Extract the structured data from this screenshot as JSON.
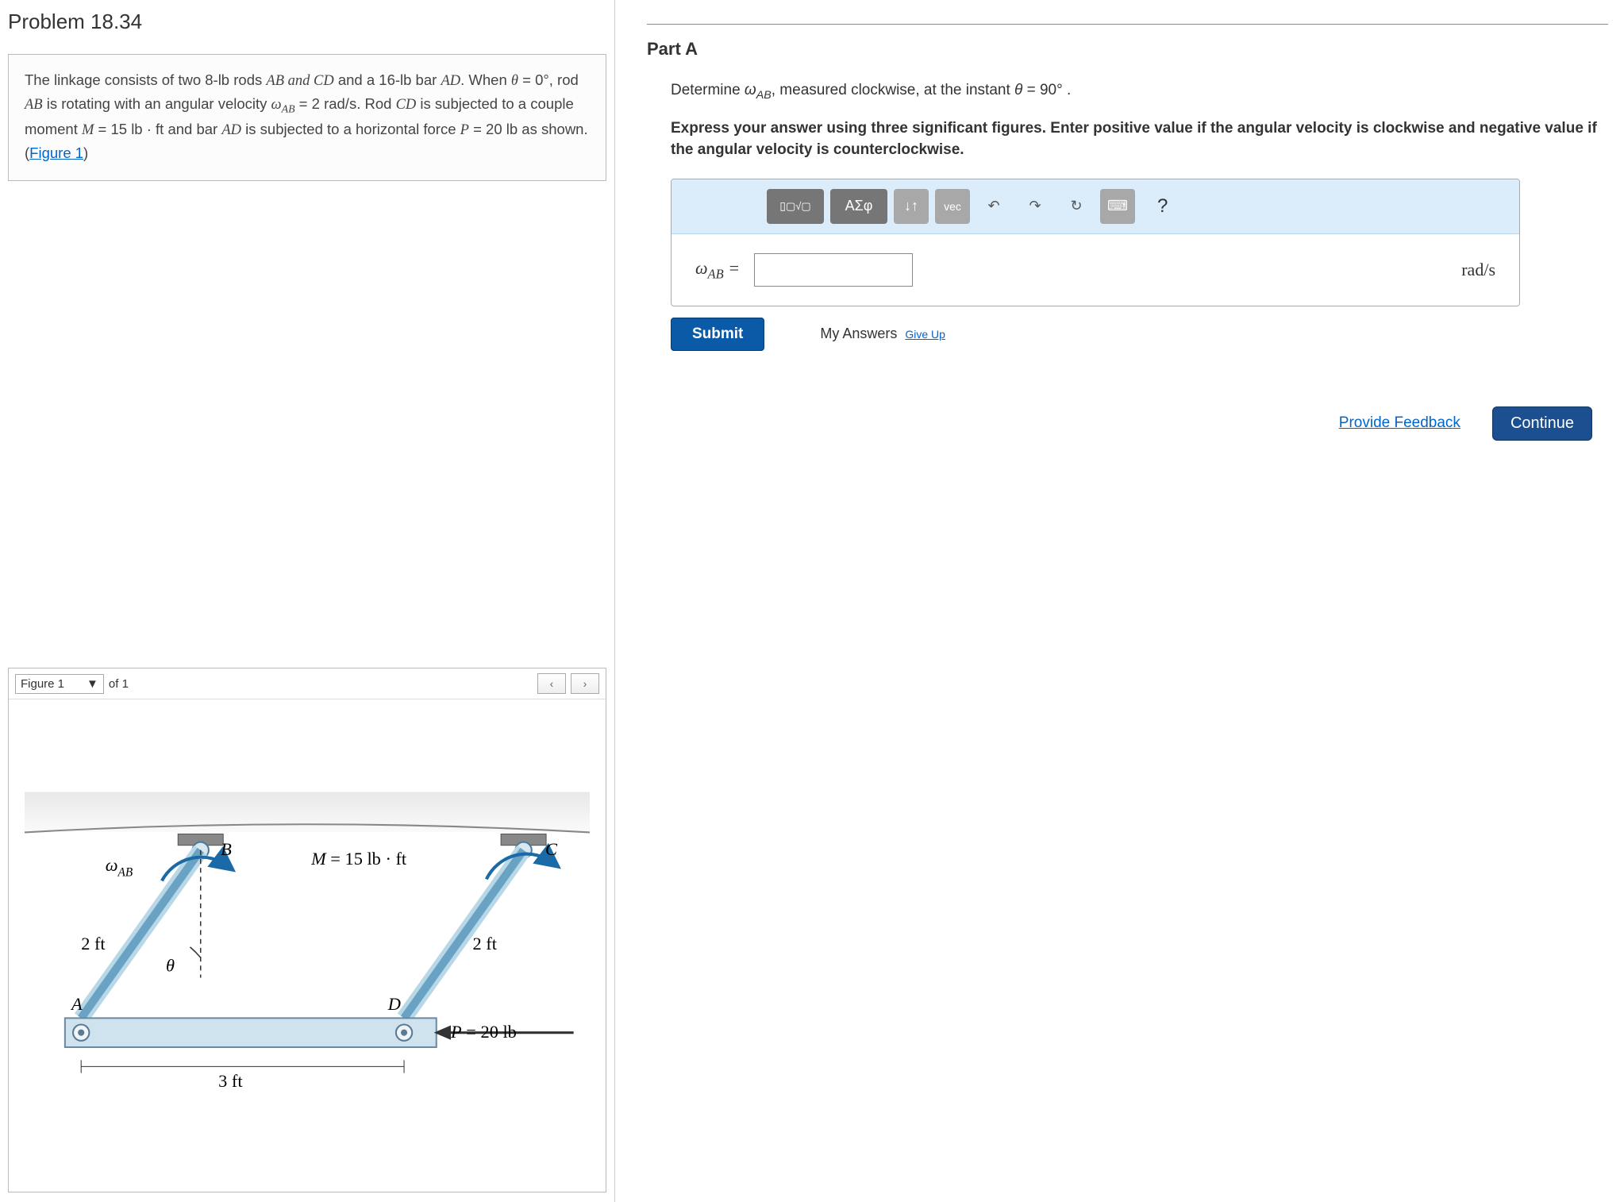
{
  "problem": {
    "title": "Problem 18.34",
    "linkage_rods_weight": "8-lb",
    "rods_labels": "AB and CD",
    "bar_weight": "16-lb",
    "bar_label": "AD",
    "theta_initial": "0°",
    "rotating_rod": "AB",
    "omega_label": "ω",
    "omega_sub": "AB",
    "omega_value": "2 rad/s",
    "cd_label": "CD",
    "moment_label": "M",
    "moment_value": "15 lb · ft",
    "bar_ad": "AD",
    "force_label": "P",
    "force_value": "20 lb",
    "figure_link": "Figure 1"
  },
  "figure_selector": {
    "current": "Figure 1",
    "of_label": "of 1",
    "prev": "‹",
    "next": "›"
  },
  "figure_labels": {
    "omega": "ω",
    "omega_sub": "AB",
    "point_a": "A",
    "point_b": "B",
    "point_c": "C",
    "point_d": "D",
    "theta": "θ",
    "len_ab": "2 ft",
    "len_cd": "2 ft",
    "len_ad": "3 ft",
    "moment": "M = 15 lb · ft",
    "force": "P = 20 lb"
  },
  "partA": {
    "header": "Part A",
    "instr_pre": "Determine ",
    "instr_var": "ω",
    "instr_sub": "AB",
    "instr_post": ", measured clockwise, at the instant ",
    "theta_var": "θ",
    "theta_eq": " = 90° .",
    "bold_instr": "Express your answer using three significant figures. Enter positive value if the angular velocity is clockwise and negative value if the angular velocity is counterclockwise.",
    "toolbar": {
      "templates": "▢√▢",
      "greek": "ΑΣφ",
      "subsup": "↓↑",
      "vec": "vec",
      "undo": "↶",
      "redo": "↷",
      "reset": "↻",
      "keyboard": "⌨",
      "help": "?"
    },
    "answer_var": "ω",
    "answer_sub": "AB",
    "equals": " = ",
    "input_value": "",
    "unit": "rad/s",
    "submit": "Submit",
    "my_answers": "My Answers",
    "give_up": "Give Up"
  },
  "footer": {
    "feedback": "Provide Feedback",
    "continue": "Continue"
  }
}
